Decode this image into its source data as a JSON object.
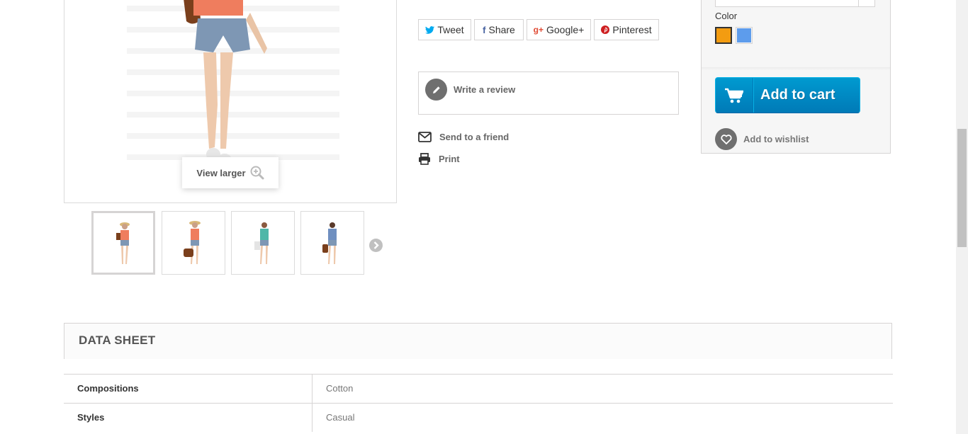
{
  "gallery": {
    "view_larger_label": "View larger",
    "thumbnails": [
      {
        "label": "thumbnail 1"
      },
      {
        "label": "thumbnail 2"
      },
      {
        "label": "thumbnail 3"
      },
      {
        "label": "thumbnail 4"
      }
    ]
  },
  "social": {
    "tweet_label": "Tweet",
    "share_label": "Share",
    "googleplus_label": "Google+",
    "pinterest_label": "Pinterest"
  },
  "actions": {
    "write_review_label": "Write a review",
    "send_friend_label": "Send to a friend",
    "print_label": "Print"
  },
  "buy_box": {
    "color_label": "Color",
    "swatches": [
      "#f39c11",
      "#5d9cec"
    ],
    "add_to_cart_label": "Add to cart",
    "add_to_wishlist_label": "Add to wishlist",
    "accent_color": "#0088cc"
  },
  "data_sheet": {
    "title": "DATA SHEET",
    "rows": [
      {
        "key": "Compositions",
        "value": "Cotton"
      },
      {
        "key": "Styles",
        "value": "Casual"
      }
    ]
  }
}
